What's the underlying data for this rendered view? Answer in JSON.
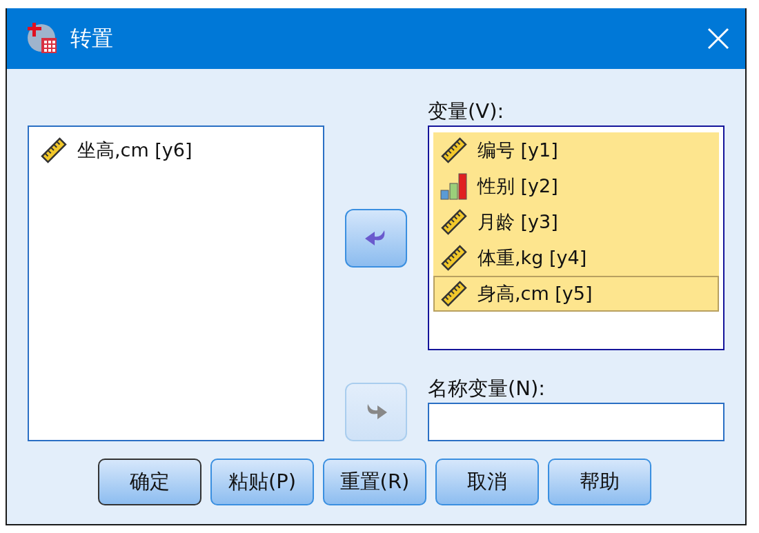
{
  "window": {
    "title": "转置"
  },
  "source_list": {
    "items": [
      {
        "label": "坐高,cm [y6]",
        "kind": "scale",
        "selected": false,
        "focused": false
      }
    ]
  },
  "move_to_variables_button": {
    "disabled": false
  },
  "variables": {
    "label": "变量(V):",
    "items": [
      {
        "label": "编号 [y1]",
        "kind": "scale",
        "selected": true,
        "focused": false
      },
      {
        "label": "性别 [y2]",
        "kind": "nominal",
        "selected": true,
        "focused": false
      },
      {
        "label": "月龄 [y3]",
        "kind": "scale",
        "selected": true,
        "focused": false
      },
      {
        "label": "体重,kg [y4]",
        "kind": "scale",
        "selected": true,
        "focused": false
      },
      {
        "label": "身高,cm [y5]",
        "kind": "scale",
        "selected": true,
        "focused": true
      }
    ]
  },
  "move_to_name_button": {
    "disabled": true
  },
  "name_variable": {
    "label": "名称变量(N):"
  },
  "buttons": [
    {
      "label": "确定",
      "default": true
    },
    {
      "label": "粘贴(P)",
      "default": false
    },
    {
      "label": "重置(R)",
      "default": false
    },
    {
      "label": "取消",
      "default": false
    },
    {
      "label": "帮助",
      "default": false
    }
  ]
}
